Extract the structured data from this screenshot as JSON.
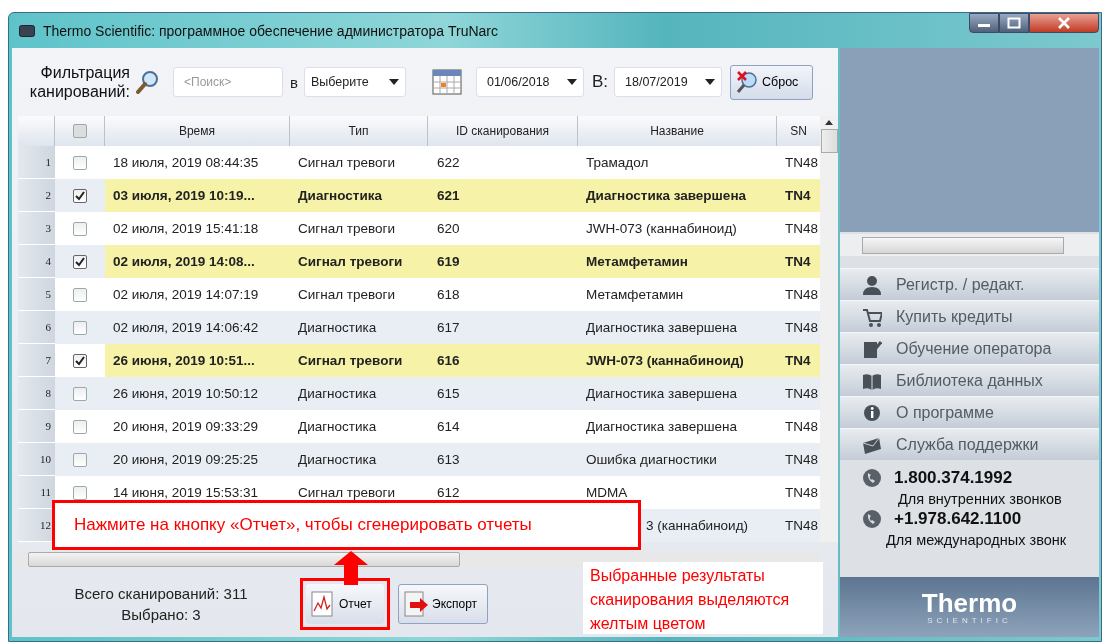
{
  "window": {
    "title": "Thermo Scientific: программное обеспечение администратора TruNarc"
  },
  "filter": {
    "label": "Фильтрация канирований:",
    "search": {
      "placeholder": "<Поиск>"
    },
    "in_label": "в",
    "field_select": "Выберите",
    "date_from": "01/06/2018",
    "to_label": "В:",
    "date_to": "18/07/2019",
    "reset": "Сброс"
  },
  "table": {
    "header_checked": false,
    "columns": [
      "Время",
      "Тип",
      "ID сканирования",
      "Название",
      "SN"
    ],
    "rows": [
      {
        "num": "1",
        "checked": false,
        "time": "18 июля, 2019 08:44:35",
        "type": "Сигнал тревоги",
        "id": "622",
        "name": "Трамадол",
        "sn": "TN48"
      },
      {
        "num": "2",
        "checked": true,
        "time": "03 июля, 2019 10:19...",
        "type": "Диагностика",
        "id": "621",
        "name": "Диагностика завершена",
        "sn": "TN4"
      },
      {
        "num": "3",
        "checked": false,
        "time": "02 июля, 2019 15:41:18",
        "type": "Сигнал тревоги",
        "id": "620",
        "name": "JWH-073 (каннабиноид)",
        "sn": "TN48"
      },
      {
        "num": "4",
        "checked": true,
        "time": "02 июля, 2019 14:08...",
        "type": "Сигнал тревоги",
        "id": "619",
        "name": "Метамфетамин",
        "sn": "TN4"
      },
      {
        "num": "5",
        "checked": false,
        "time": "02 июля, 2019 14:07:19",
        "type": "Сигнал тревоги",
        "id": "618",
        "name": "Метамфетамин",
        "sn": "TN48"
      },
      {
        "num": "6",
        "checked": false,
        "time": "02 июля, 2019 14:06:42",
        "type": "Диагностика",
        "id": "617",
        "name": "Диагностика завершена",
        "sn": "TN48"
      },
      {
        "num": "7",
        "checked": true,
        "time": "26 июня, 2019 10:51...",
        "type": "Сигнал тревоги",
        "id": "616",
        "name": "JWH-073 (каннабиноид)",
        "sn": "TN4"
      },
      {
        "num": "8",
        "checked": false,
        "time": "26 июня, 2019 10:50:12",
        "type": "Диагностика",
        "id": "615",
        "name": "Диагностика завершена",
        "sn": "TN48"
      },
      {
        "num": "9",
        "checked": false,
        "time": "20 июня, 2019 09:33:29",
        "type": "Диагностика",
        "id": "614",
        "name": "Диагностика завершена",
        "sn": "TN48"
      },
      {
        "num": "10",
        "checked": false,
        "time": "20 июня, 2019 09:25:25",
        "type": "Диагностика",
        "id": "613",
        "name": "Ошибка диагностики",
        "sn": "TN48"
      },
      {
        "num": "11",
        "checked": false,
        "time": "14 июня, 2019 15:53:31",
        "type": "Сигнал тревоги",
        "id": "612",
        "name": "MDMA",
        "sn": "TN48"
      },
      {
        "num": "12",
        "name": "3 (каннабиноид)",
        "sn": "TN48"
      }
    ]
  },
  "footer": {
    "total": "Всего сканирований: 311",
    "selected": "Выбрано: 3",
    "buttons": [
      "Отчет",
      "Экспорт"
    ]
  },
  "sidebar": {
    "items": [
      "Регистр. / редакт.",
      "Купить кредиты",
      "Обучение оператора",
      "Библиотека данных",
      "О программе",
      "Служба поддержки"
    ],
    "contacts": [
      {
        "phone": "1.800.374.1992",
        "note": "Для внутренних звонков"
      },
      {
        "phone": "+1.978.642.1100",
        "note": "Для международных звонк"
      }
    ],
    "logo": {
      "name": "Thermo",
      "sub": "SCIENTIFIC"
    }
  },
  "annotations": {
    "callout": "Нажмите на кнопку «Отчет», чтобы сгенерировать отчеты",
    "note": "Выбранные результаты сканирования выделяются желтым цветом"
  }
}
